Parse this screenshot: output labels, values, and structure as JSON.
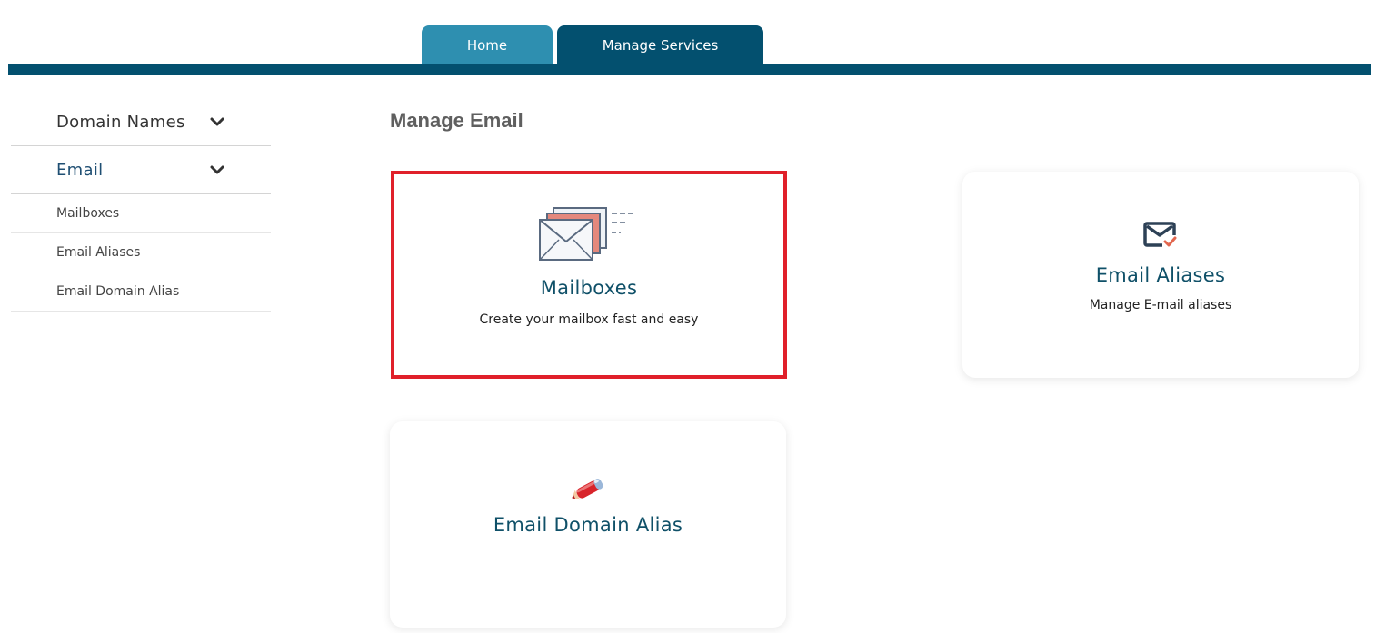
{
  "tabs": [
    {
      "label": "Home"
    },
    {
      "label": "Manage Services"
    }
  ],
  "sidebar": {
    "sections": [
      {
        "label": "Domain Names"
      },
      {
        "label": "Email"
      }
    ],
    "email_items": [
      {
        "label": "Mailboxes"
      },
      {
        "label": "Email Aliases"
      },
      {
        "label": "Email Domain Alias"
      }
    ]
  },
  "main": {
    "title": "Manage Email",
    "cards": [
      {
        "title": "Mailboxes",
        "description": "Create your mailbox fast and easy",
        "icon": "mailbox-envelopes-icon"
      },
      {
        "title": "Email Aliases",
        "description": "Manage E-mail aliases",
        "icon": "email-check-icon"
      },
      {
        "title": "Email Domain Alias",
        "description": "",
        "icon": "pencil-icon"
      }
    ]
  },
  "colors": {
    "nav_dark": "#03506f",
    "nav_light": "#2e8fb0",
    "highlight": "#e0202a",
    "card_title": "#0f5068"
  }
}
